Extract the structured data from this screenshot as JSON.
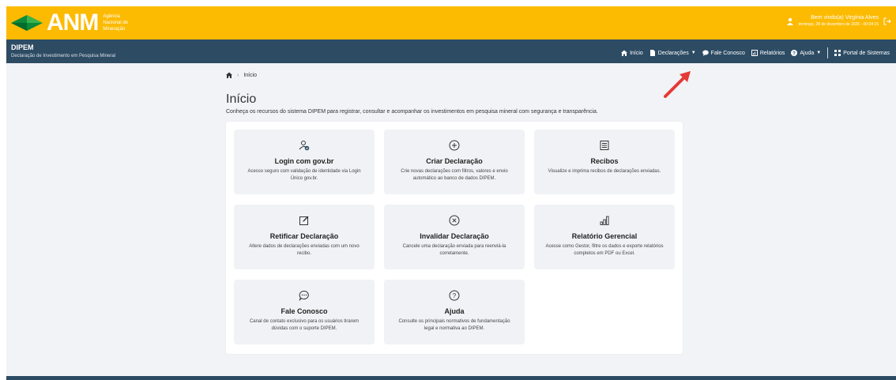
{
  "header": {
    "logo_text": "ANM",
    "agency_lines": [
      "Agência",
      "Nacional de",
      "Mineração"
    ],
    "user_greeting": "Bem vindo(a) Virgínia Alves",
    "user_date": "domingo, 28 de dezembro de 2025 - 00:04:15"
  },
  "system": {
    "title": "DIPEM",
    "subtitle": "Declaração de Investimento em Pesquisa Mineral"
  },
  "nav": {
    "inicio": "Início",
    "declaracoes": "Declarações",
    "fale": "Fale Conosco",
    "relatorios": "Relatórios",
    "ajuda": "Ajuda",
    "portal": "Portal de Sistemas"
  },
  "breadcrumb": {
    "current": "Início"
  },
  "page": {
    "title": "Início",
    "description": "Conheça os recursos do sistema DIPEM para registrar, consultar e acompanhar os investimentos em pesquisa mineral com segurança e transparência."
  },
  "cards": [
    {
      "icon": "user-check-icon",
      "title": "Login com gov.br",
      "desc": "Acesso seguro com validação de identidade via Login Único gov.br."
    },
    {
      "icon": "plus-circle-icon",
      "title": "Criar Declaração",
      "desc": "Crie novas declarações com filtros, valores e envio automático ao banco de dados DIPEM."
    },
    {
      "icon": "receipt-icon",
      "title": "Recibos",
      "desc": "Visualize e imprima recibos de declarações enviadas."
    },
    {
      "icon": "edit-icon",
      "title": "Retificar Declaração",
      "desc": "Altere dados de declarações enviadas com um novo recibo."
    },
    {
      "icon": "x-circle-icon",
      "title": "Invalidar Declaração",
      "desc": "Cancele uma declaração enviada para reenviá-la corretamente."
    },
    {
      "icon": "bar-chart-icon",
      "title": "Relatório Gerencial",
      "desc": "Acesse como Gestor, filtre os dados e exporte relatórios completos em PDF ou Excel."
    },
    {
      "icon": "chat-icon",
      "title": "Fale Conosco",
      "desc": "Canal de contato exclusivo para os usuários tirarem dúvidas com o suporte DIPEM."
    },
    {
      "icon": "help-circle-icon",
      "title": "Ajuda",
      "desc": "Consulte os principais normativos de fundamentação legal e normativa ao DIPEM."
    }
  ],
  "colors": {
    "header_yellow": "#fcba00",
    "nav_blue": "#2d4b63",
    "card_bg": "#f0f2f5",
    "annotation_arrow": "#e53935"
  }
}
